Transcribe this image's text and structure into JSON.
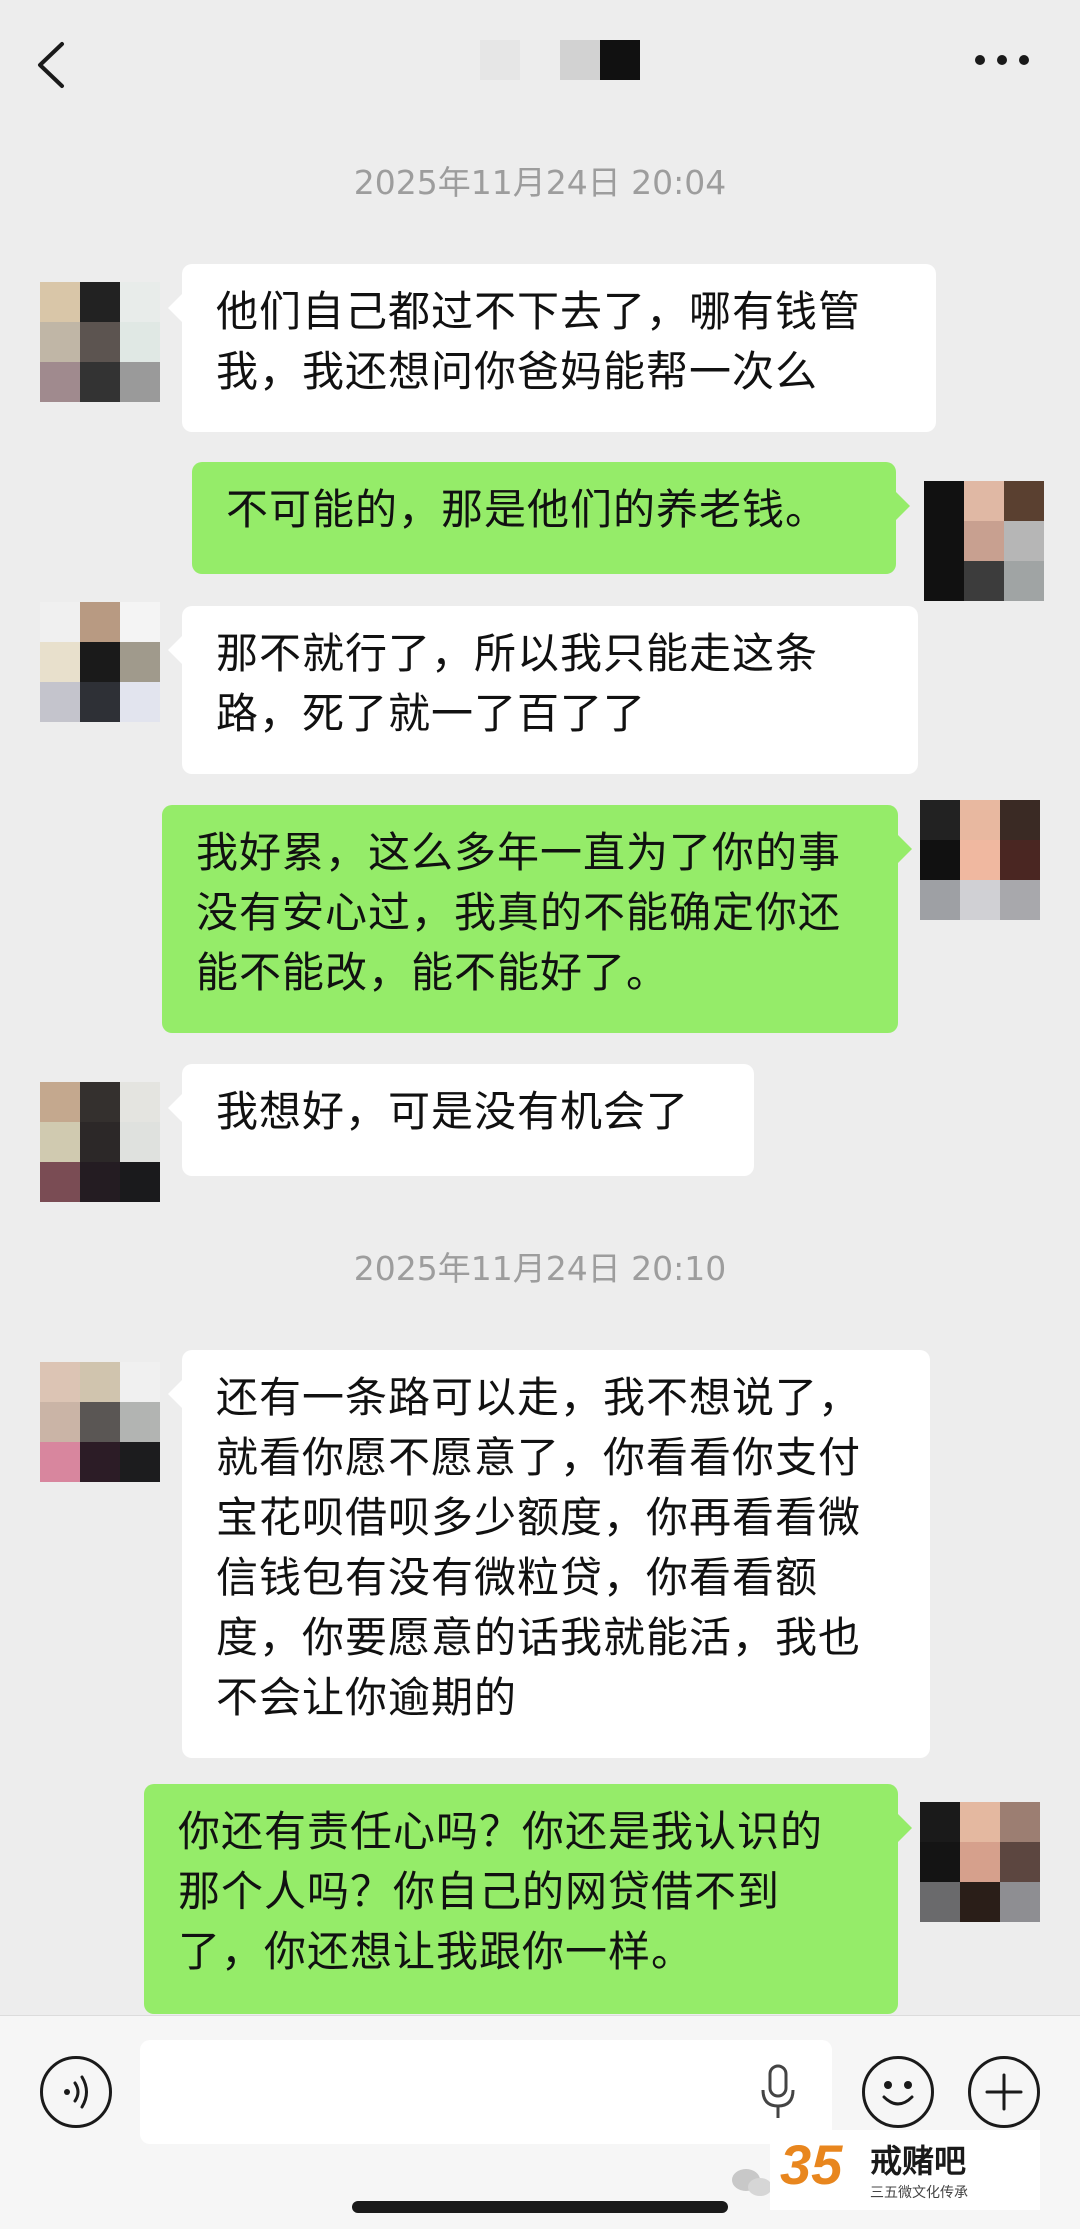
{
  "header": {
    "back_icon": "chevron-left-icon",
    "contact_name_blurred": true,
    "more_icon": "ellipsis-icon"
  },
  "timestamps": [
    "2025年11月24日 20:04",
    "2025年11月24日 20:10"
  ],
  "messages": [
    {
      "side": "in",
      "lines": [
        "他们自己都过不下去了，哪有钱管",
        "我，我还想问你爸妈能帮一次么"
      ]
    },
    {
      "side": "out",
      "lines": [
        "不可能的，那是他们的养老钱。"
      ]
    },
    {
      "side": "in",
      "lines": [
        "那不就行了，所以我只能走这条",
        "路，死了就一了百了了"
      ]
    },
    {
      "side": "out",
      "lines": [
        "我好累，这么多年一直为了你的事",
        "没有安心过，我真的不能确定你还",
        "能不能改，能不能好了。"
      ]
    },
    {
      "side": "in",
      "lines": [
        "我想好，可是没有机会了"
      ]
    },
    {
      "side": "in",
      "lines": [
        "还有一条路可以走，我不想说了，",
        "就看你愿不愿意了，你看看你支付",
        "宝花呗借呗多少额度，你再看看微",
        "信钱包有没有微粒贷，你看看额",
        "度，你要愿意的话我就能活，我也",
        "不会让你逾期的"
      ]
    },
    {
      "side": "out",
      "lines": [
        "你还有责任心吗？你还是我认识的",
        "那个人吗？你自己的网贷借不到",
        "了，你还想让我跟你一样。"
      ]
    }
  ],
  "input_bar": {
    "voice_icon": "voice-wave-icon",
    "mic_icon": "microphone-icon",
    "emoji_icon": "smiley-icon",
    "plus_icon": "plus-icon"
  },
  "watermark": {
    "number": "35",
    "brand": "戒赌吧",
    "slogan": "三五微文化传承"
  },
  "colors": {
    "background": "#ededed",
    "outgoing_bubble": "#95ec69",
    "incoming_bubble": "#ffffff",
    "timestamp": "#9d9d9d"
  }
}
